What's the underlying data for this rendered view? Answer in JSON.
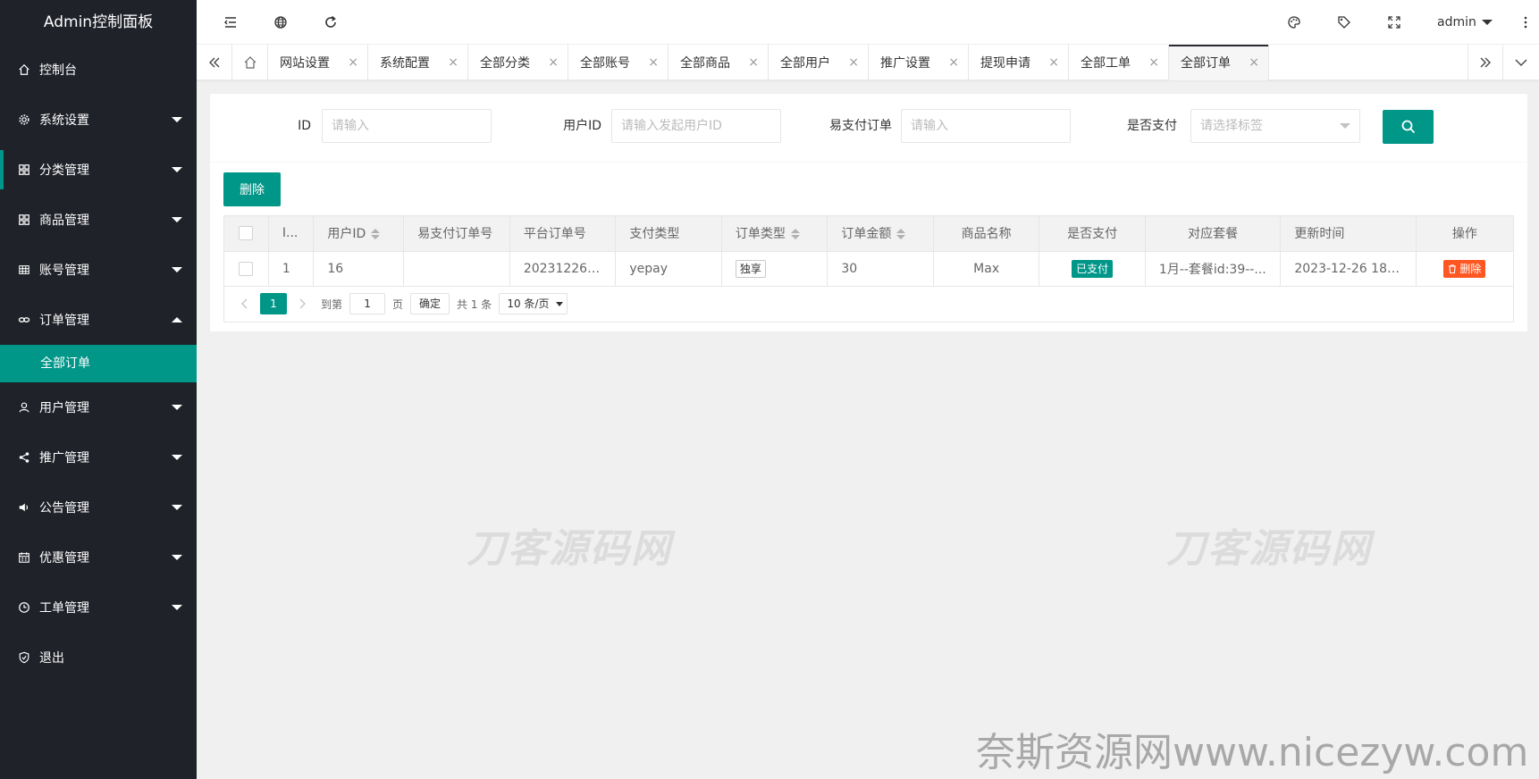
{
  "app": {
    "title": "Admin控制面板",
    "user": "admin"
  },
  "sidebar": {
    "items": [
      {
        "label": "控制台",
        "icon": "home-icon"
      },
      {
        "label": "系统设置",
        "icon": "gear-icon"
      },
      {
        "label": "分类管理",
        "icon": "apps-icon"
      },
      {
        "label": "商品管理",
        "icon": "apps-icon"
      },
      {
        "label": "账号管理",
        "icon": "grid-icon"
      },
      {
        "label": "订单管理",
        "icon": "link-icon"
      },
      {
        "label": "全部订单",
        "icon": ""
      },
      {
        "label": "用户管理",
        "icon": "user-icon"
      },
      {
        "label": "推广管理",
        "icon": "share-icon"
      },
      {
        "label": "公告管理",
        "icon": "speaker-icon"
      },
      {
        "label": "优惠管理",
        "icon": "calendar-icon"
      },
      {
        "label": "工单管理",
        "icon": "clock-icon"
      },
      {
        "label": "退出",
        "icon": "shield-icon"
      }
    ]
  },
  "tabs": [
    "网站设置",
    "系统配置",
    "全部分类",
    "全部账号",
    "全部商品",
    "全部用户",
    "推广设置",
    "提现申请",
    "全部工单",
    "全部订单"
  ],
  "search": {
    "id_label": "ID",
    "id_placeholder": "请输入",
    "user_label": "用户ID",
    "user_placeholder": "请输入发起用户ID",
    "order_label": "易支付订单",
    "order_placeholder": "请输入",
    "paid_label": "是否支付",
    "paid_placeholder": "请选择标签"
  },
  "toolbar": {
    "delete_label": "删除"
  },
  "table": {
    "headers": [
      "I...",
      "用户ID",
      "易支付订单号",
      "平台订单号",
      "支付类型",
      "订单类型",
      "订单金额",
      "商品名称",
      "是否支付",
      "对应套餐",
      "更新时间",
      "操作"
    ],
    "rows": [
      {
        "id": "1",
        "user_id": "16",
        "epay_order": "",
        "platform_order": "2023122612...",
        "pay_type": "yepay",
        "order_type": "独享",
        "amount": "30",
        "product": "Max",
        "paid": "已支付",
        "plan": "1月--套餐id:39--...",
        "updated": "2023-12-26 18:2...",
        "action": "删除"
      }
    ]
  },
  "pager": {
    "current": "1",
    "goto_label": "到第",
    "goto_value": "1",
    "page_unit": "页",
    "confirm": "确定",
    "total": "共 1 条",
    "page_size": "10 条/页"
  },
  "watermarks": {
    "a": "刀客源码网",
    "b": "刀客源码网",
    "c": "奈斯资源网www.nicezyw.com"
  },
  "colors": {
    "sidebar_bg": "#20222a",
    "accent": "#009688",
    "danger": "#ff5722"
  }
}
